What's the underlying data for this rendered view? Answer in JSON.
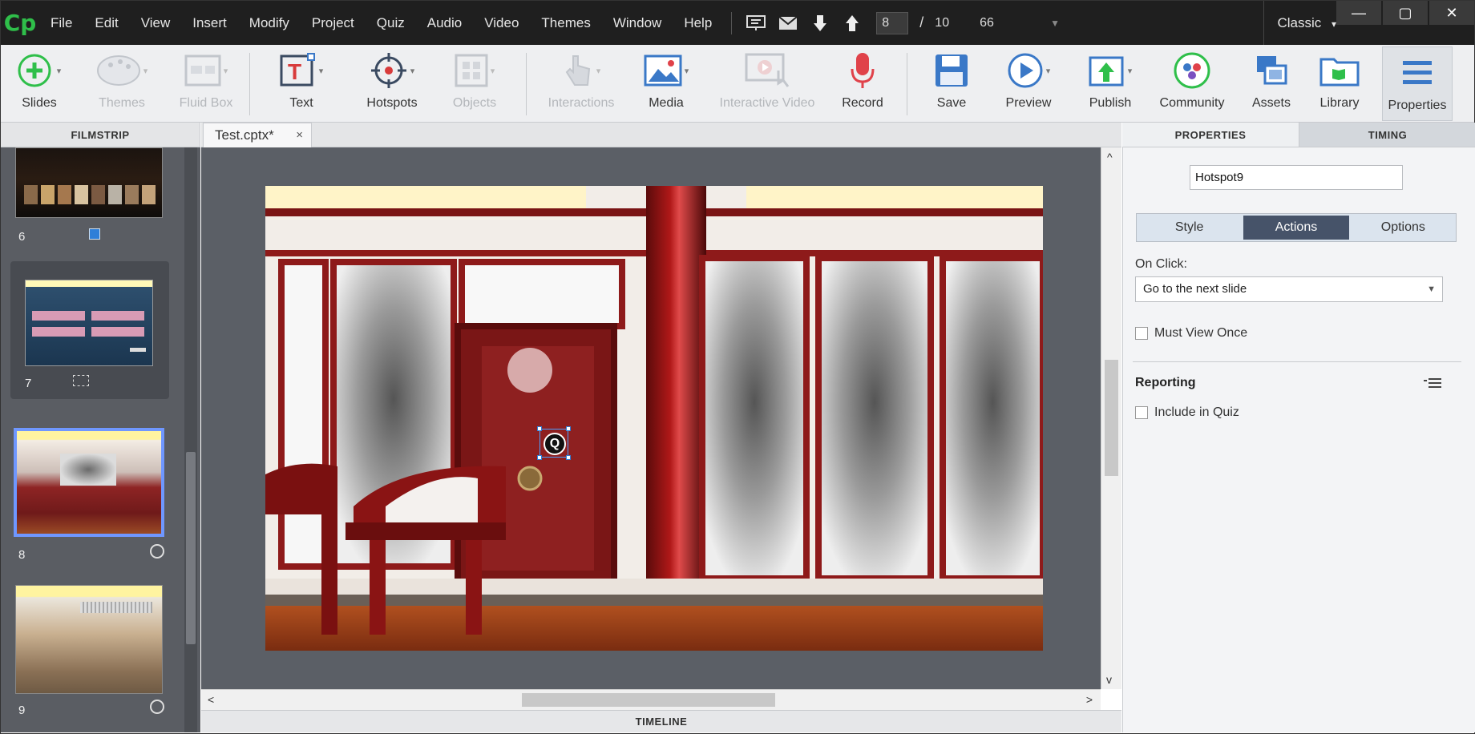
{
  "app": {
    "logo": "Cp",
    "menu": [
      "File",
      "Edit",
      "View",
      "Insert",
      "Modify",
      "Project",
      "Quiz",
      "Audio",
      "Video",
      "Themes",
      "Window",
      "Help"
    ],
    "current_slide": "8",
    "page_sep": "/",
    "total_slides": "10",
    "zoom": "66",
    "workspace": "Classic",
    "workspace_caret": "▾",
    "window_buttons": [
      "—",
      "▢",
      "✕"
    ]
  },
  "toolbar": {
    "items": [
      {
        "label": "Slides",
        "icon": "plus-circle-icon",
        "enabled": true
      },
      {
        "label": "Themes",
        "icon": "palette-icon",
        "enabled": false
      },
      {
        "label": "Fluid Box",
        "icon": "fluid-box-icon",
        "enabled": false
      },
      {
        "label": "Text",
        "icon": "text-icon",
        "enabled": true
      },
      {
        "label": "Hotspots",
        "icon": "crosshair-icon",
        "enabled": true
      },
      {
        "label": "Objects",
        "icon": "objects-icon",
        "enabled": false
      },
      {
        "label": "Interactions",
        "icon": "hand-pointer-icon",
        "enabled": false
      },
      {
        "label": "Media",
        "icon": "image-icon",
        "enabled": true
      },
      {
        "label": "Interactive Video",
        "icon": "interactive-video-icon",
        "enabled": false
      },
      {
        "label": "Record",
        "icon": "microphone-icon",
        "enabled": true
      },
      {
        "label": "Save",
        "icon": "floppy-icon",
        "enabled": true
      },
      {
        "label": "Preview",
        "icon": "play-icon",
        "enabled": true
      },
      {
        "label": "Publish",
        "icon": "publish-icon",
        "enabled": true
      },
      {
        "label": "Community",
        "icon": "community-icon",
        "enabled": true
      },
      {
        "label": "Assets",
        "icon": "assets-icon",
        "enabled": true
      },
      {
        "label": "Library",
        "icon": "library-icon",
        "enabled": true
      },
      {
        "label": "Properties",
        "icon": "properties-icon",
        "enabled": true
      }
    ]
  },
  "panels": {
    "filmstrip": "FILMSTRIP",
    "properties": "PROPERTIES",
    "timing": "TIMING",
    "timeline": "TIMELINE"
  },
  "document": {
    "tab_title": "Test.cptx*",
    "close": "×"
  },
  "filmstrip": {
    "slides": [
      {
        "number": "6"
      },
      {
        "number": "7"
      },
      {
        "number": "8",
        "selected": true
      },
      {
        "number": "9"
      }
    ]
  },
  "stage": {
    "hotspot_label": "Q"
  },
  "properties": {
    "object_name": "Hotspot9",
    "subtabs": [
      "Style",
      "Actions",
      "Options"
    ],
    "active_subtab": "Actions",
    "on_click_label": "On Click:",
    "on_click_value": "Go to the next slide",
    "must_view_once": "Must View Once",
    "reporting": "Reporting",
    "include_in_quiz": "Include in Quiz"
  },
  "colors": {
    "menubar": "#1f1f1f",
    "accent_green": "#2fbf4a",
    "selected_thumb": "#6f97ff",
    "active_segment": "#465369",
    "record_red": "#e0424a"
  }
}
